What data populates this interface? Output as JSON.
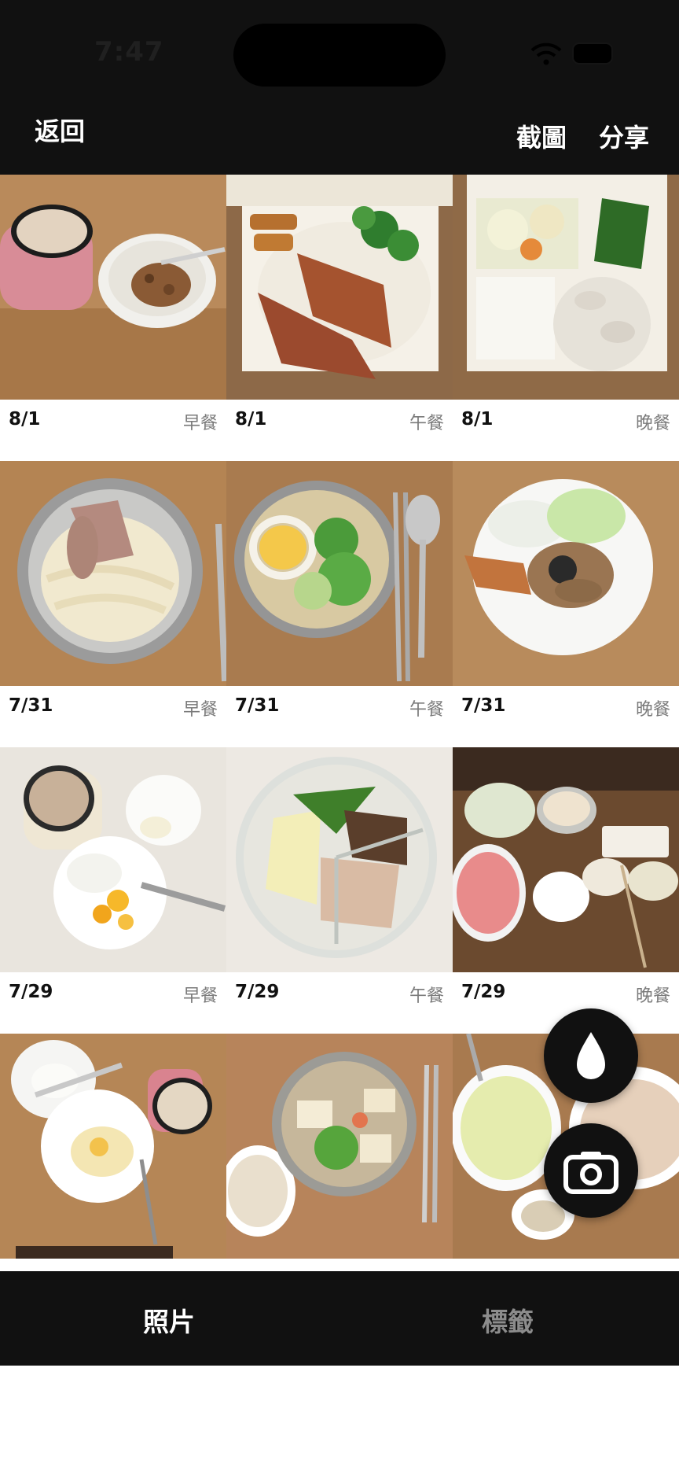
{
  "status_bar": {
    "time": "7:47"
  },
  "nav": {
    "back": "返回",
    "capture": "截圖",
    "share": "分享"
  },
  "grid": {
    "tiles": [
      {
        "date": "8/1",
        "meal": "早餐"
      },
      {
        "date": "8/1",
        "meal": "午餐"
      },
      {
        "date": "8/1",
        "meal": "晚餐"
      },
      {
        "date": "7/31",
        "meal": "早餐"
      },
      {
        "date": "7/31",
        "meal": "午餐"
      },
      {
        "date": "7/31",
        "meal": "晚餐"
      },
      {
        "date": "7/29",
        "meal": "早餐"
      },
      {
        "date": "7/29",
        "meal": "午餐"
      },
      {
        "date": "7/29",
        "meal": "晚餐"
      }
    ]
  },
  "fab": {
    "drop_icon": "water-drop-icon",
    "camera_icon": "camera-icon"
  },
  "tabs": {
    "photos": "照片",
    "tags": "標籤",
    "active": "photos"
  },
  "colors": {
    "bar": "#111111",
    "inactive_tab": "#8c8c8c",
    "meal_label": "#7a7a7a"
  }
}
